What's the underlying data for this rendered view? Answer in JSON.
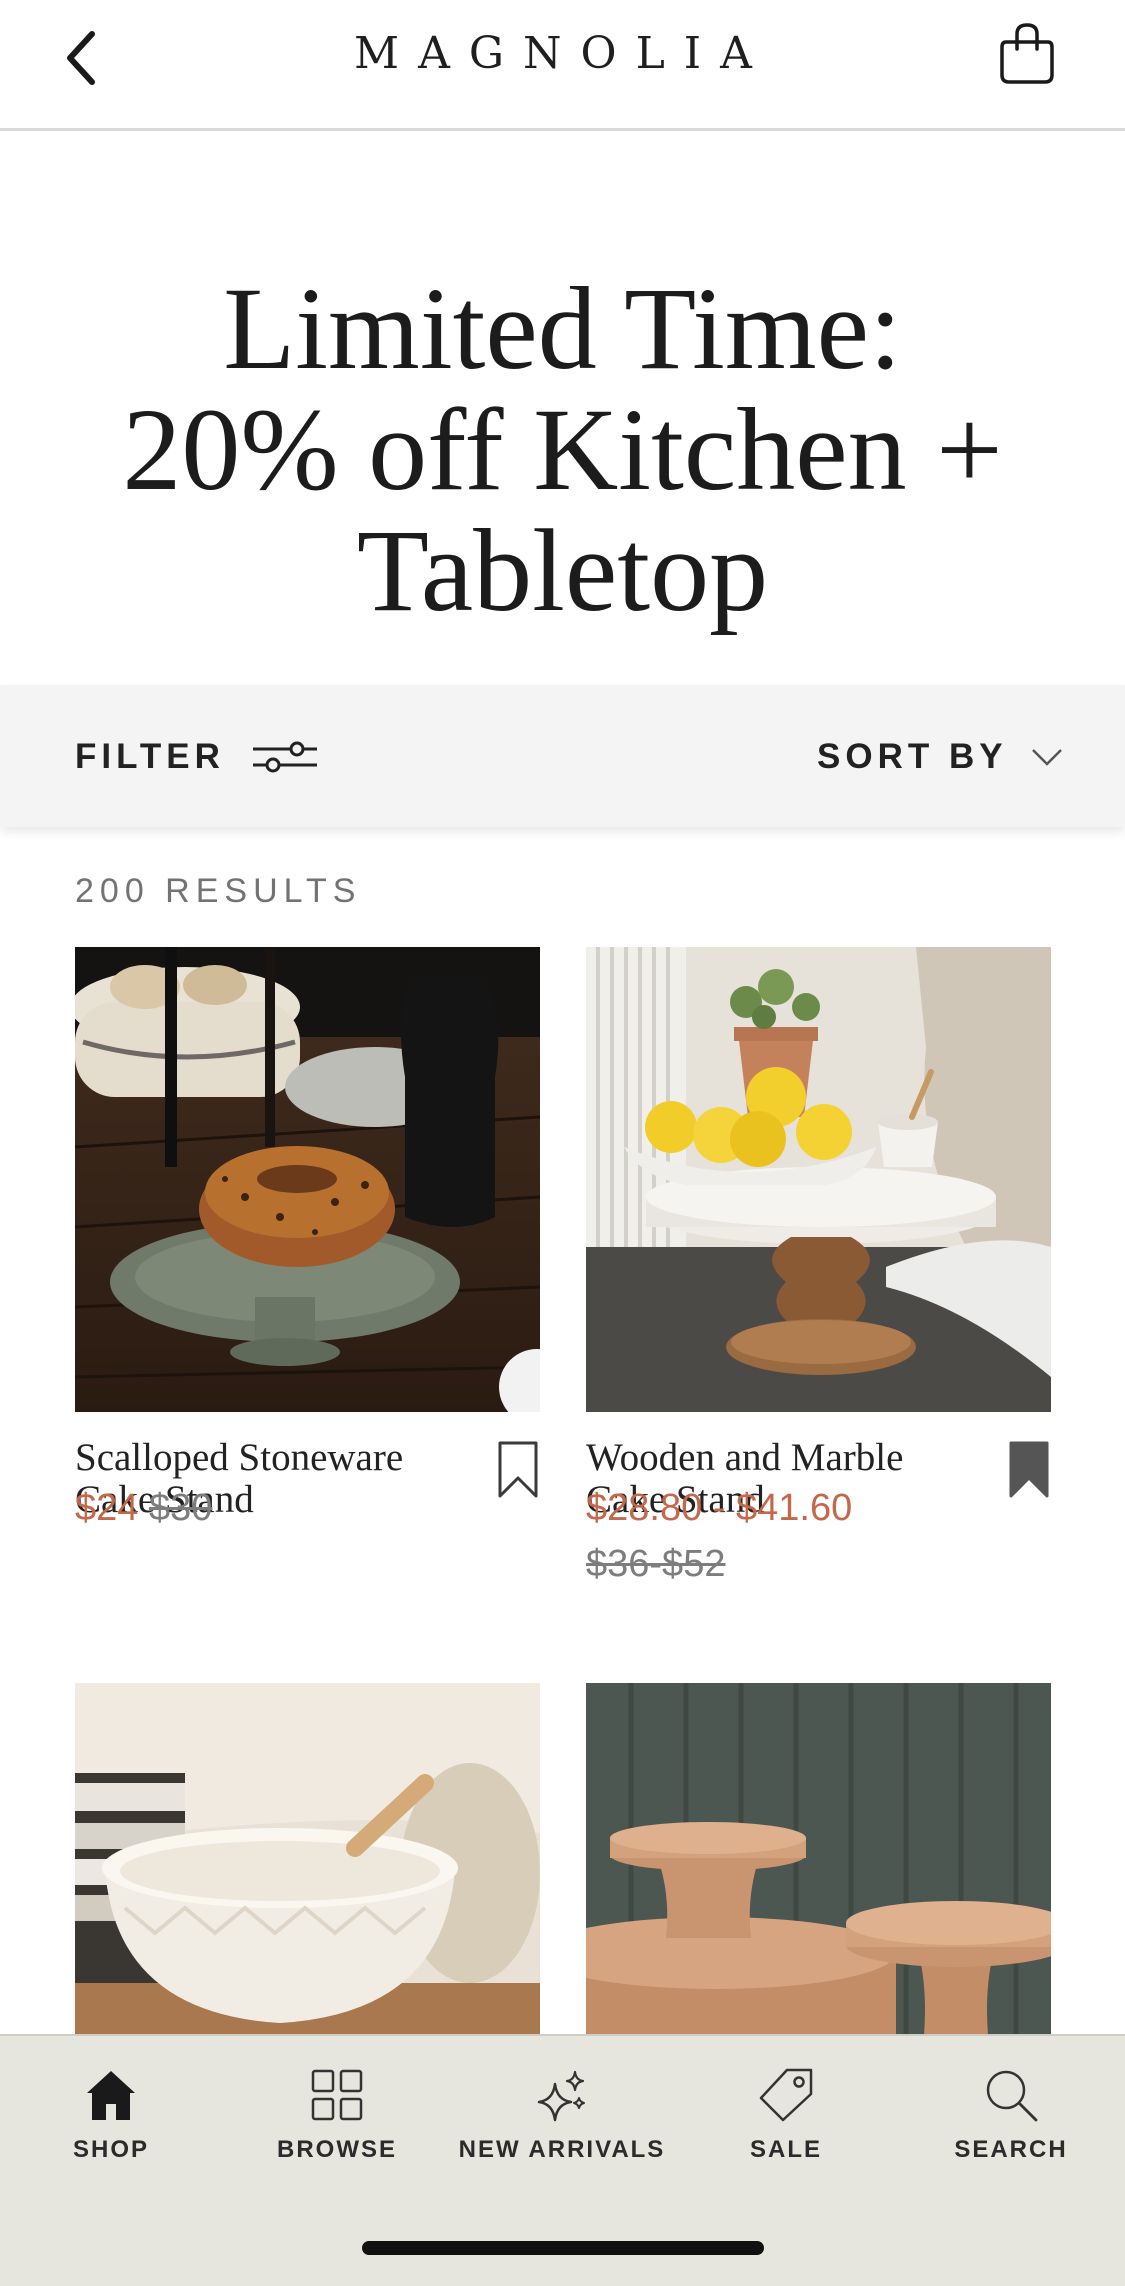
{
  "header": {
    "logo_text": "MAGNOLIA",
    "back_icon": "chevron-left-icon",
    "bag_icon": "shopping-bag-icon"
  },
  "promo": {
    "title_lines": [
      "Limited Time:",
      "20% off Kitchen +",
      "Tabletop"
    ]
  },
  "toolbar": {
    "filter_label": "FILTER",
    "filter_icon": "sliders-icon",
    "sort_label": "SORT BY",
    "sort_icon": "chevron-down-icon",
    "background": "#f4f4f4"
  },
  "results_text": "200 RESULTS",
  "products": [
    {
      "name_lines": [
        "Scalloped Stoneware",
        "Cake Stand"
      ],
      "sale_price": "$24",
      "original_price": "$30",
      "bookmarked": false,
      "image": "bundt-cake-on-green-stand"
    },
    {
      "name_lines": [
        "Wooden and Marble",
        "Cake Stand"
      ],
      "sale_price": "$28.80 - $41.60",
      "original_price": "$36-$52",
      "bookmarked": true,
      "image": "lemons-on-marble-wood-stand"
    },
    {
      "image": "cream-mixing-bowl"
    },
    {
      "image": "wooden-pedestal-stands"
    }
  ],
  "tabbar": {
    "items": [
      {
        "label": "SHOP",
        "icon": "home-icon",
        "active": true
      },
      {
        "label": "BROWSE",
        "icon": "grid-icon",
        "active": false
      },
      {
        "label": "NEW ARRIVALS",
        "icon": "sparkle-icon",
        "active": false
      },
      {
        "label": "SALE",
        "icon": "tag-icon",
        "active": false
      },
      {
        "label": "SEARCH",
        "icon": "search-icon",
        "active": false
      }
    ]
  },
  "colors": {
    "sale_price": "#c4684c",
    "original_price": "#7d7d7d",
    "tabbar_background": "#e6e5de"
  }
}
